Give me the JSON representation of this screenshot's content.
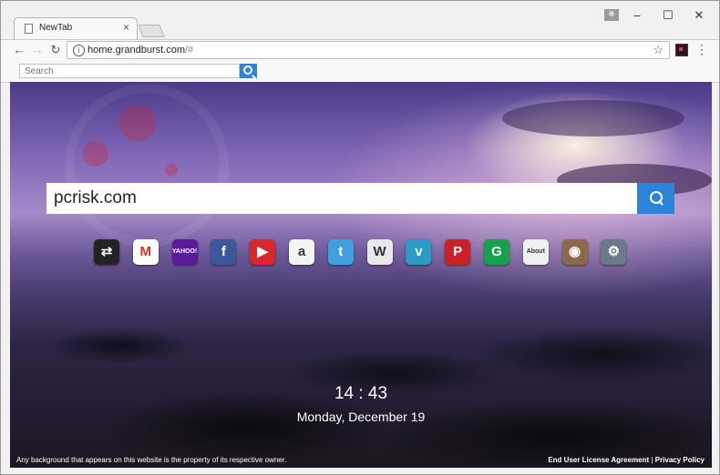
{
  "browser": {
    "tab_title": "NewTab",
    "url_host": "home.grandburst.com",
    "url_path": "/#"
  },
  "toolbar_search": {
    "placeholder": "Search"
  },
  "main_search": {
    "value": "pcrisk.com"
  },
  "apps": [
    {
      "name": "switcher",
      "color": "#222222",
      "label": "⇄"
    },
    {
      "name": "gmail",
      "color": "#ffffff",
      "label": "M"
    },
    {
      "name": "yahoo",
      "color": "#5a1a9a",
      "label": "YAHOO!"
    },
    {
      "name": "facebook",
      "color": "#3b5998",
      "label": "f"
    },
    {
      "name": "youtube",
      "color": "#d9272e",
      "label": "▶"
    },
    {
      "name": "amazon",
      "color": "#f4f4f4",
      "label": "a"
    },
    {
      "name": "twitter",
      "color": "#3ea0dc",
      "label": "t"
    },
    {
      "name": "wikipedia",
      "color": "#e8e8e8",
      "label": "W"
    },
    {
      "name": "vimeo",
      "color": "#2c9bc8",
      "label": "v"
    },
    {
      "name": "pinterest",
      "color": "#cb2027",
      "label": "P"
    },
    {
      "name": "grammarly",
      "color": "#17a14c",
      "label": "G"
    },
    {
      "name": "about",
      "color": "#f0f0f0",
      "label": "About"
    },
    {
      "name": "instagram",
      "color": "#8a6a4a",
      "label": "◉"
    },
    {
      "name": "settings",
      "color": "#6a7a8a",
      "label": "⚙"
    }
  ],
  "clock": {
    "time": "14 : 43",
    "date": "Monday, December 19"
  },
  "footer": {
    "disclaimer": "Any background that appears on this website is the property of its respective owner.",
    "eula": "End User License Agreement",
    "separator": "|",
    "privacy": "Privacy Policy"
  }
}
